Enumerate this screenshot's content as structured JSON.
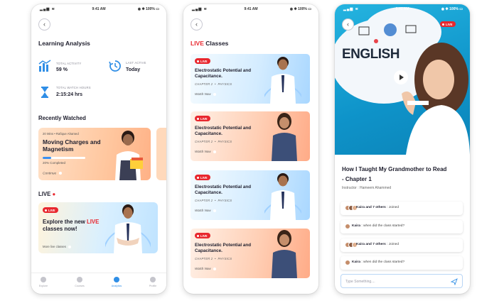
{
  "status": {
    "time": "9:41 AM",
    "battery": "100%"
  },
  "screen1": {
    "title": "Learning Analysis",
    "stats": {
      "total_activity_label": "TOTAL ACTIVITY",
      "total_activity_value": "59 %",
      "last_active_label": "LAST ACTIVE",
      "last_active_value": "Today",
      "watch_hours_label": "TOTAL WATCH HOURS",
      "watch_hours_value": "2:15:24 hrs"
    },
    "recent_title": "Recently Watched",
    "recent_card": {
      "meta": "20 Mins  •  Rafique Ahamed",
      "title": "Moving Charges and Magnetism",
      "progress": 0.2,
      "completed": "20% Completed",
      "continue": "Continue"
    },
    "live_title": "LIVE",
    "live_card": {
      "badge": "LIVE",
      "explore_1": "Explore the new",
      "explore_live": "LIVE",
      "explore_2": "classes now!",
      "more": "More live classes"
    },
    "tabs": [
      "Explore",
      "Courses",
      "Analytics",
      "Profile"
    ]
  },
  "screen2": {
    "title_live": "LIVE",
    "title_rest": " Classes",
    "cards": [
      {
        "badge": "LIVE",
        "title": "Electrostatic Potential and Capacitance.",
        "chapter": "CHAPTER 2",
        "subject": "PHYSICS",
        "watch": "Watch Now"
      },
      {
        "badge": "LIVE",
        "title": "Electrostatic Potential and Capacitance.",
        "chapter": "CHAPTER 2",
        "subject": "PHYSICS",
        "watch": "Watch Now"
      },
      {
        "badge": "LIVE",
        "title": "Electrostatic Potential and Capacitance.",
        "chapter": "CHAPTER 2",
        "subject": "PHYSICS",
        "watch": "Watch Now"
      },
      {
        "badge": "LIVE",
        "title": "Electrostatic Potential and Capacitance.",
        "chapter": "CHAPTER 2",
        "subject": "PHYSICS",
        "watch": "Watch Now"
      }
    ]
  },
  "screen3": {
    "badge": "LIVE",
    "video_word": "ENGLISH",
    "title": "How I Taught My Grandmother to Read - Chapter 1",
    "instructor": "Instructor : Hameem Ahammed",
    "chat": [
      {
        "name": "Kaira and 7 others",
        "text": ": Joined"
      },
      {
        "name": "Kaira",
        "text": ": when did the class started?"
      },
      {
        "name": "Kaira and 7 others",
        "text": ": Joined"
      },
      {
        "name": "Kaira",
        "text": ": when did the class started?"
      }
    ],
    "input_placeholder": "Type Something....",
    "colors": {
      "accent": "#e8272e",
      "primary": "#2f8ee6"
    }
  }
}
